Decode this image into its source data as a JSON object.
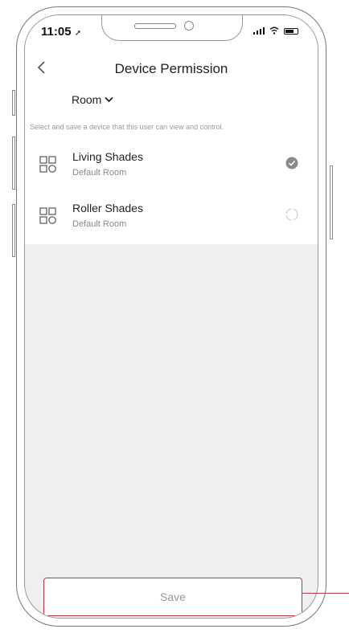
{
  "status_bar": {
    "time": "11:05"
  },
  "header": {
    "title": "Device Permission"
  },
  "room_filter": {
    "label": "Room"
  },
  "instruction": "Select and save a device that this user can view and control.",
  "devices": [
    {
      "name": "Living Shades",
      "room": "Default Room",
      "selected": true
    },
    {
      "name": "Roller Shades",
      "room": "Default Room",
      "selected": false
    }
  ],
  "footer": {
    "save_label": "Save"
  },
  "colors": {
    "accent_border": "#b23a48",
    "background": "#efefef"
  }
}
